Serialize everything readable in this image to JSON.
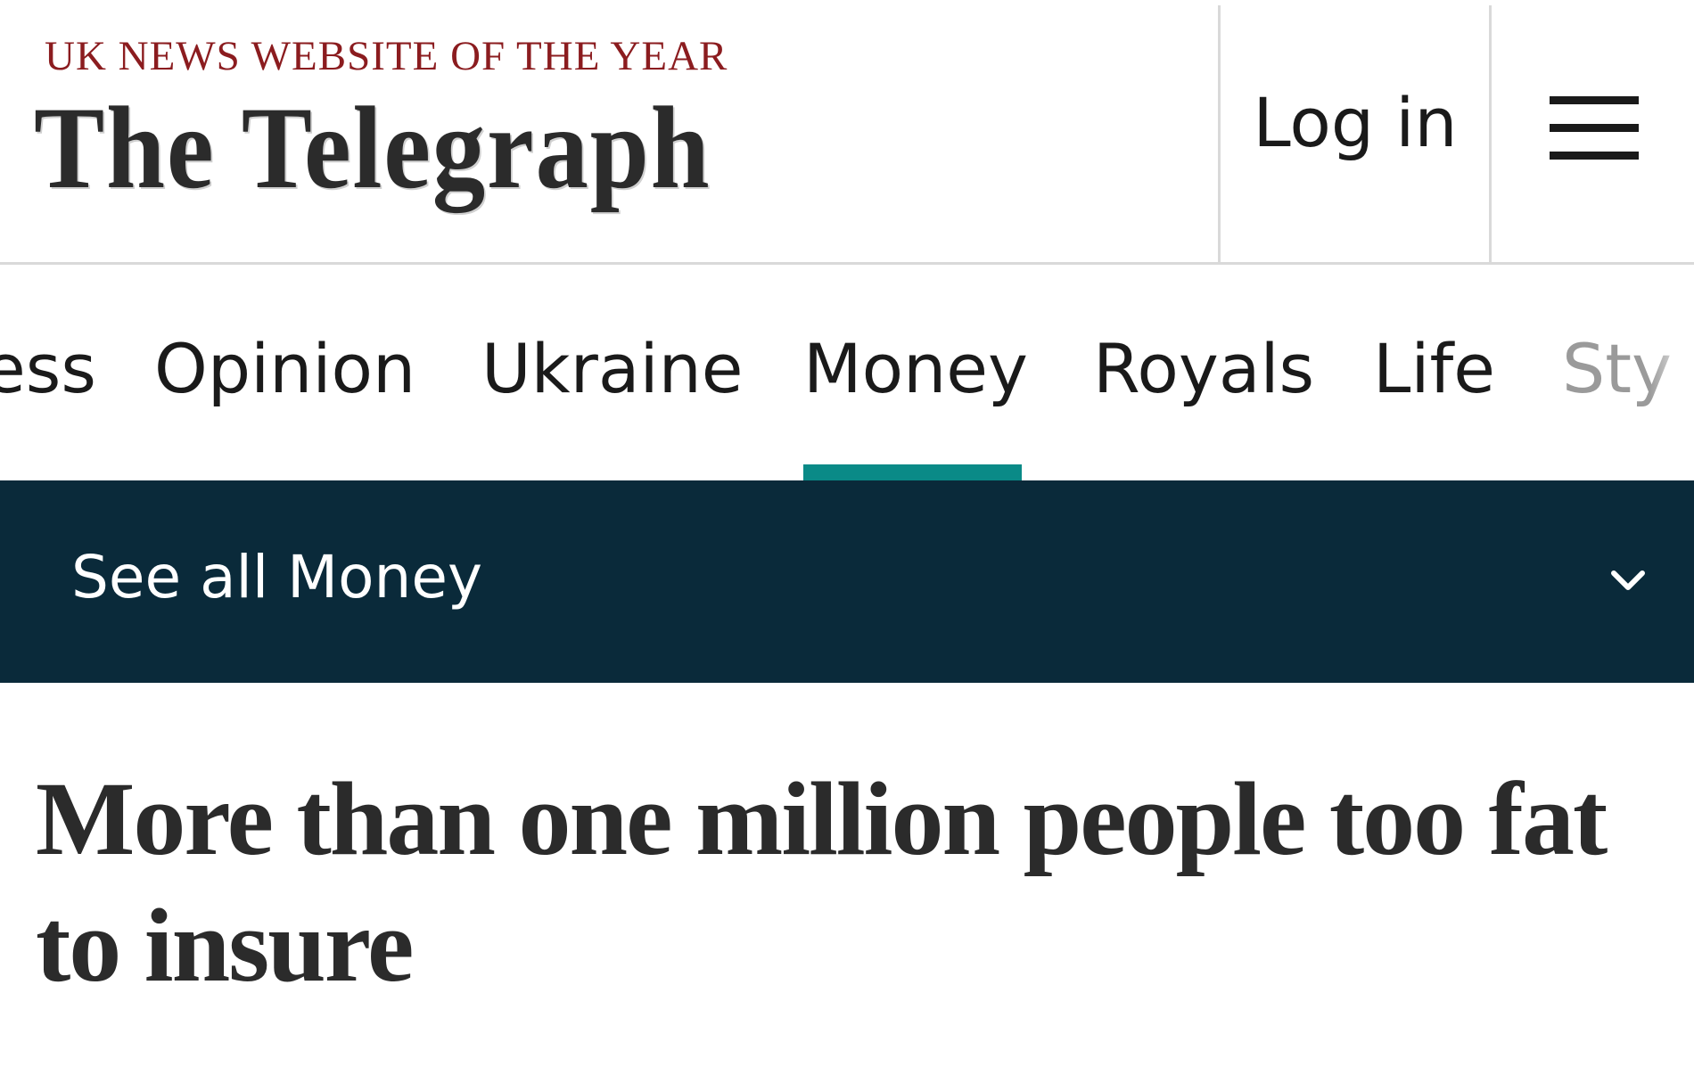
{
  "header": {
    "tagline": "UK NEWS WEBSITE OF THE YEAR",
    "masthead": "The Telegraph",
    "login_label": "Log in",
    "menu_icon": "hamburger-menu-icon"
  },
  "section_nav": {
    "active": "Money",
    "items": [
      {
        "label": "ess"
      },
      {
        "label": "Opinion"
      },
      {
        "label": "Ukraine"
      },
      {
        "label": "Money"
      },
      {
        "label": "Royals"
      },
      {
        "label": "Life"
      },
      {
        "label": "Sty"
      }
    ],
    "accent_color": "#0a8a87"
  },
  "subnav": {
    "see_all_label": "See all Money",
    "toggle_icon": "chevron-down-icon",
    "background_color": "#0a2a3a"
  },
  "article": {
    "headline": "More than one million people too fat to insure"
  },
  "colors": {
    "tagline": "#8b1c1f",
    "text": "#1a1a1a"
  }
}
